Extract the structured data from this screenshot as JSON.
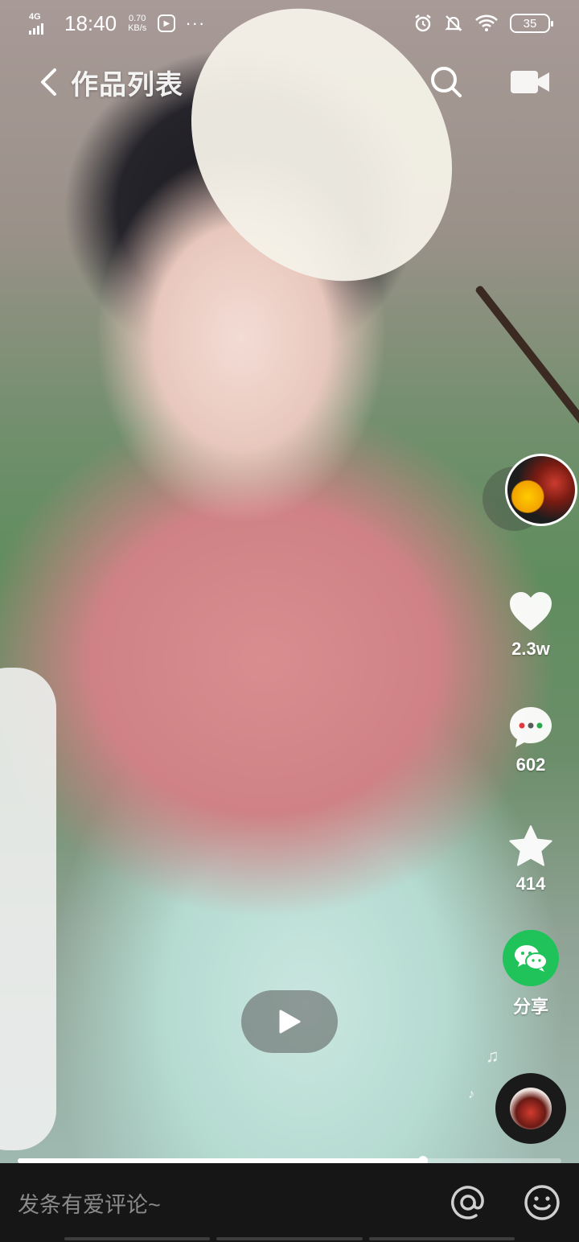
{
  "status_bar": {
    "network": "4G",
    "time": "18:40",
    "speed_value": "0.70",
    "speed_unit": "KB/s",
    "more": "···",
    "battery": "35",
    "icons": [
      "alarm-icon",
      "mute-bell-icon",
      "wifi-icon",
      "battery-icon"
    ]
  },
  "header": {
    "back_icon": "chevron-left-icon",
    "title": "作品列表",
    "search_icon": "search-icon",
    "camera_icon": "video-camera-icon"
  },
  "rail": {
    "avatar_icon": "creator-avatar",
    "like_count": "2.3w",
    "comment_count": "602",
    "favorite_count": "414",
    "share_label": "分享",
    "icons": [
      "heart-icon",
      "comment-bubble-icon",
      "star-icon",
      "wechat-icon",
      "music-disc-icon"
    ]
  },
  "player": {
    "play_icon": "play-icon",
    "progress_fraction": 0.745
  },
  "comment_bar": {
    "placeholder": "发条有爱评论~",
    "icons": [
      "at-icon",
      "emoji-icon"
    ]
  },
  "colors": {
    "wechat_green": "#1fc35a",
    "comment_bar_bg": "#161616",
    "placeholder_text": "#8a8a8a"
  }
}
